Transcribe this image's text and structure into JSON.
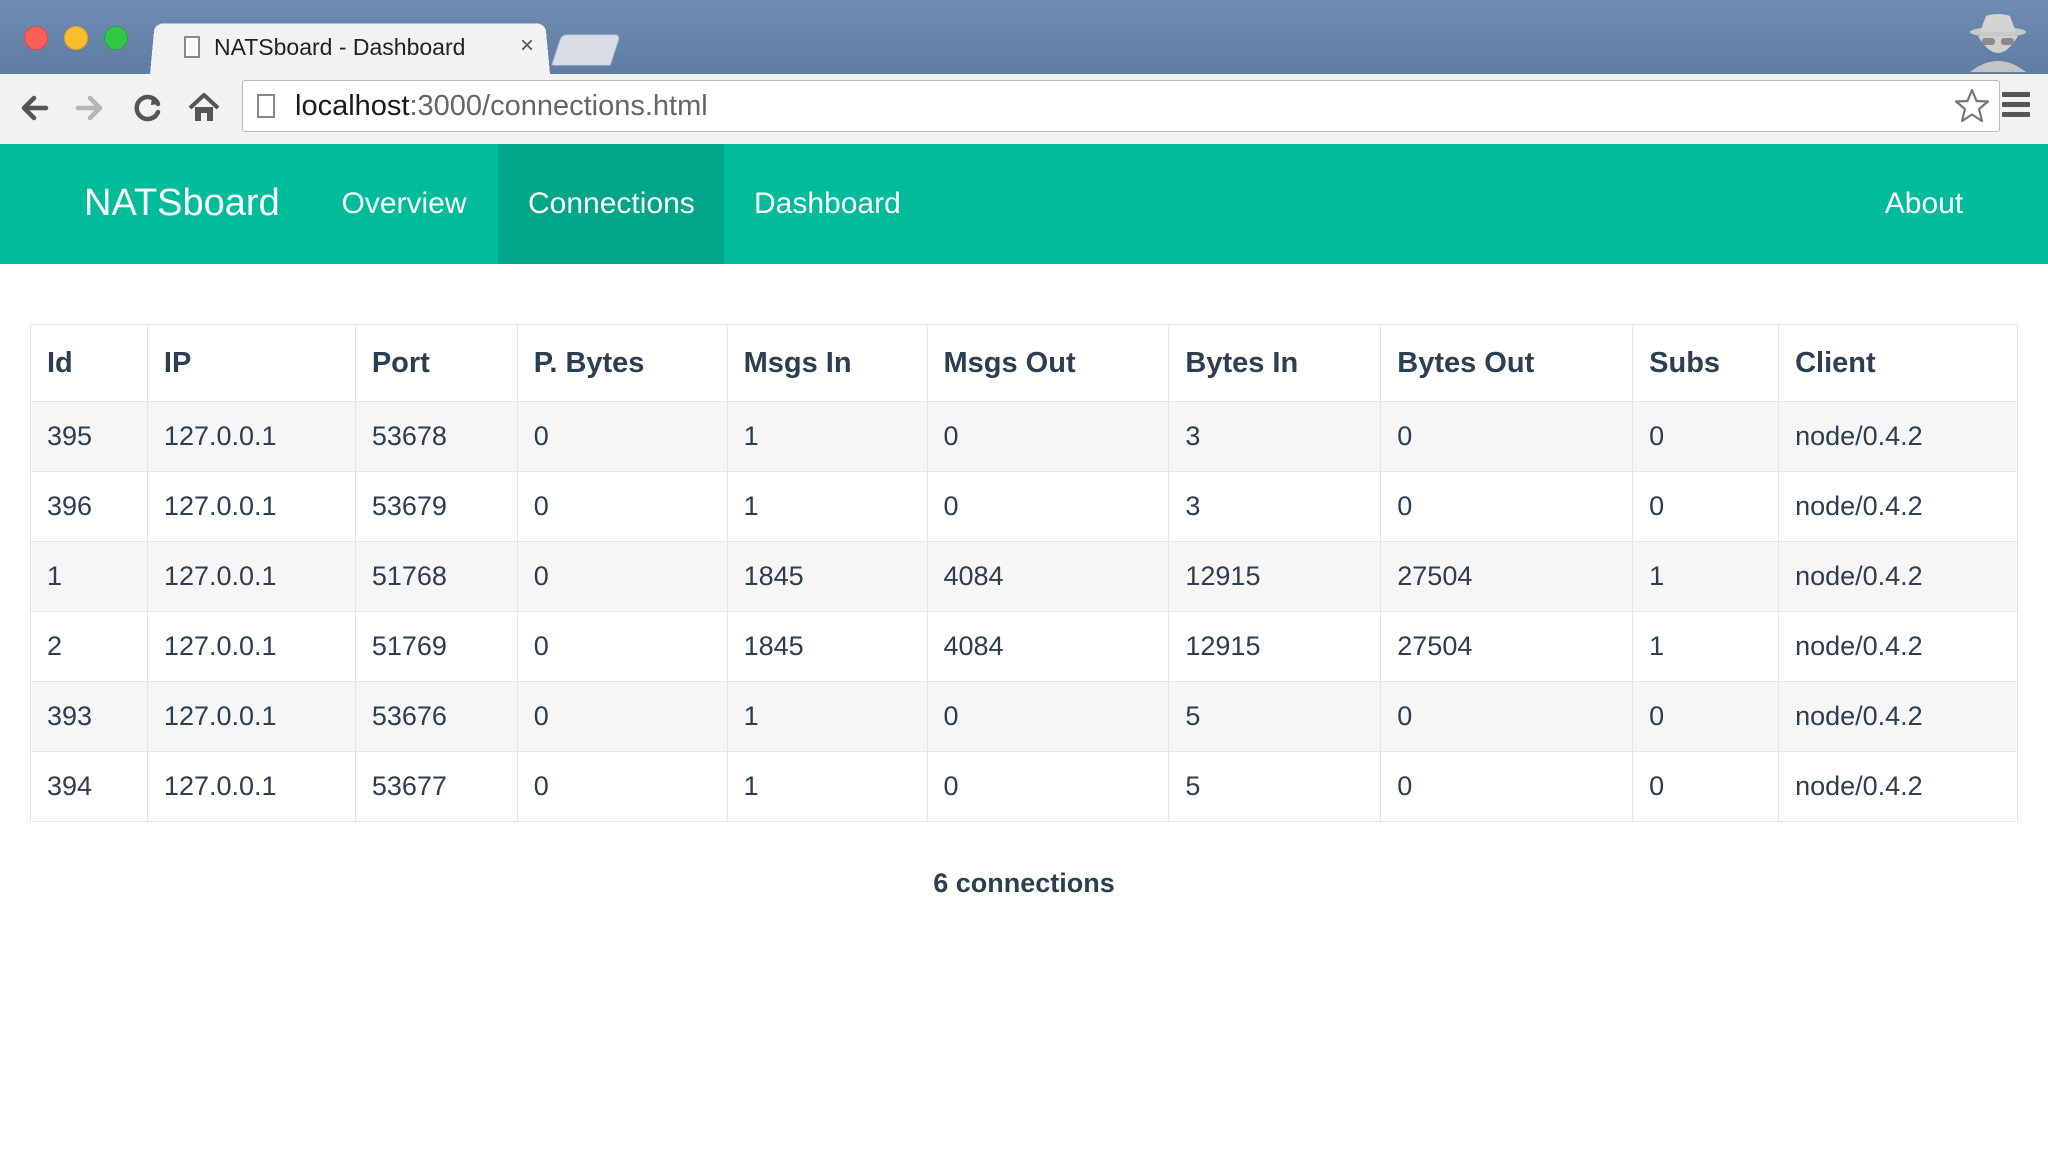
{
  "browser": {
    "tab_title": "NATSboard - Dashboard",
    "tab_close": "×",
    "url_host": "localhost",
    "url_rest": ":3000/connections.html"
  },
  "navbar": {
    "brand": "NATSboard",
    "links": [
      {
        "label": "Overview",
        "active": false
      },
      {
        "label": "Connections",
        "active": true
      },
      {
        "label": "Dashboard",
        "active": false
      }
    ],
    "about": "About",
    "bg_color": "#00bc9b",
    "active_color": "#00a687"
  },
  "table": {
    "headers": [
      "Id",
      "IP",
      "Port",
      "P. Bytes",
      "Msgs In",
      "Msgs Out",
      "Bytes In",
      "Bytes Out",
      "Subs",
      "Client"
    ],
    "rows": [
      [
        "395",
        "127.0.0.1",
        "53678",
        "0",
        "1",
        "0",
        "3",
        "0",
        "0",
        "node/0.4.2"
      ],
      [
        "396",
        "127.0.0.1",
        "53679",
        "0",
        "1",
        "0",
        "3",
        "0",
        "0",
        "node/0.4.2"
      ],
      [
        "1",
        "127.0.0.1",
        "51768",
        "0",
        "1845",
        "4084",
        "12915",
        "27504",
        "1",
        "node/0.4.2"
      ],
      [
        "2",
        "127.0.0.1",
        "51769",
        "0",
        "1845",
        "4084",
        "12915",
        "27504",
        "1",
        "node/0.4.2"
      ],
      [
        "393",
        "127.0.0.1",
        "53676",
        "0",
        "1",
        "0",
        "5",
        "0",
        "0",
        "node/0.4.2"
      ],
      [
        "394",
        "127.0.0.1",
        "53677",
        "0",
        "1",
        "0",
        "5",
        "0",
        "0",
        "node/0.4.2"
      ]
    ]
  },
  "footer": {
    "summary": "6 connections"
  }
}
